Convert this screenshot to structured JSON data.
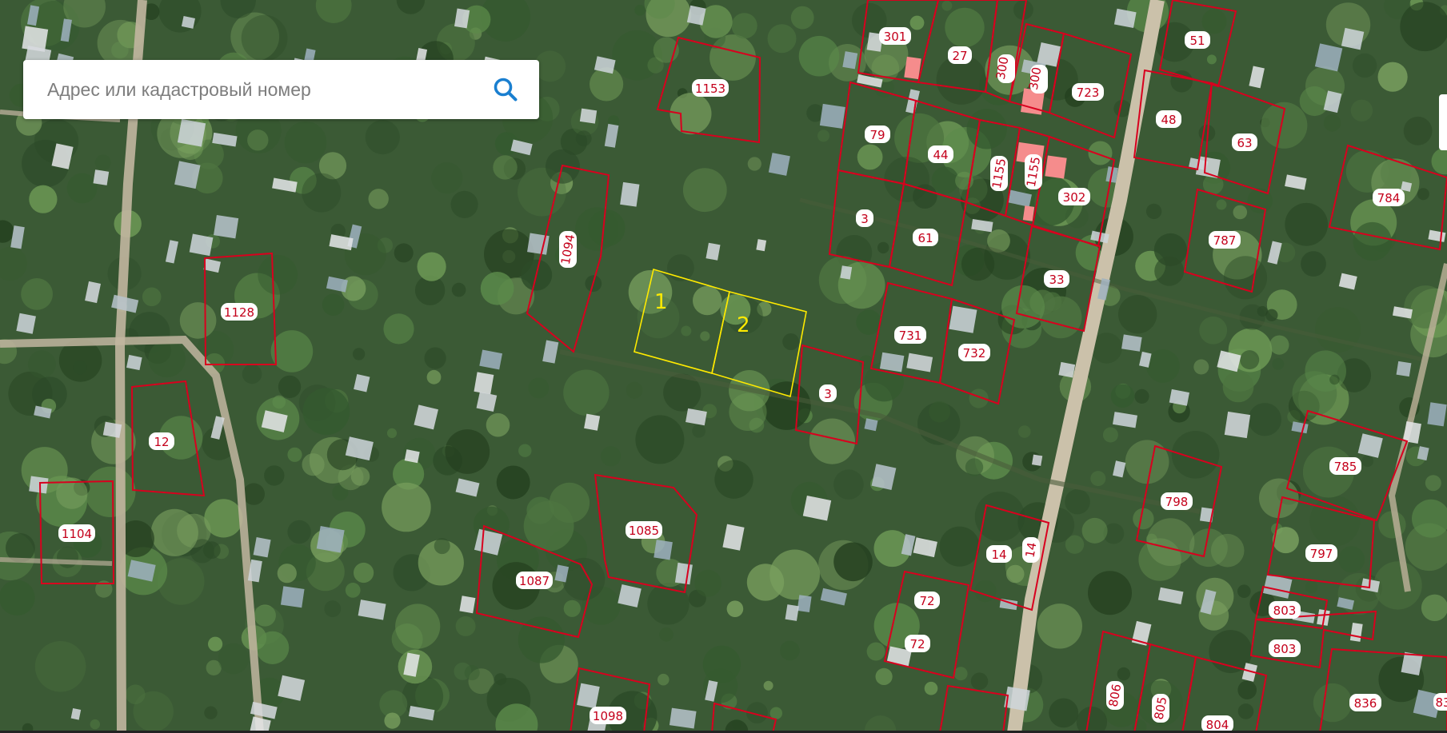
{
  "search": {
    "placeholder": "Адрес или кадастровый номер",
    "icon": "search-icon"
  },
  "colors": {
    "parcel_border": "#d8001e",
    "parcel_label_text": "#c4001b",
    "selection_border": "#ffea00",
    "selection_label": "#ffea00",
    "building_highlight": "#f58c8c",
    "road": "#c2b6a0"
  },
  "parcels": [
    "1153",
    "301",
    "27",
    "300",
    "300",
    "723",
    "51",
    "48",
    "63",
    "784",
    "79",
    "44",
    "1155",
    "1155",
    "302",
    "3",
    "61",
    "787",
    "33",
    "1094",
    "1128",
    "731",
    "732",
    "3",
    "12",
    "1104",
    "1085",
    "1087",
    "798",
    "785",
    "14",
    "14",
    "72",
    "72",
    "797",
    "803",
    "803",
    "806",
    "805",
    "804",
    "836",
    "83",
    "1098"
  ],
  "selected_parcels": [
    "1",
    "2"
  ]
}
